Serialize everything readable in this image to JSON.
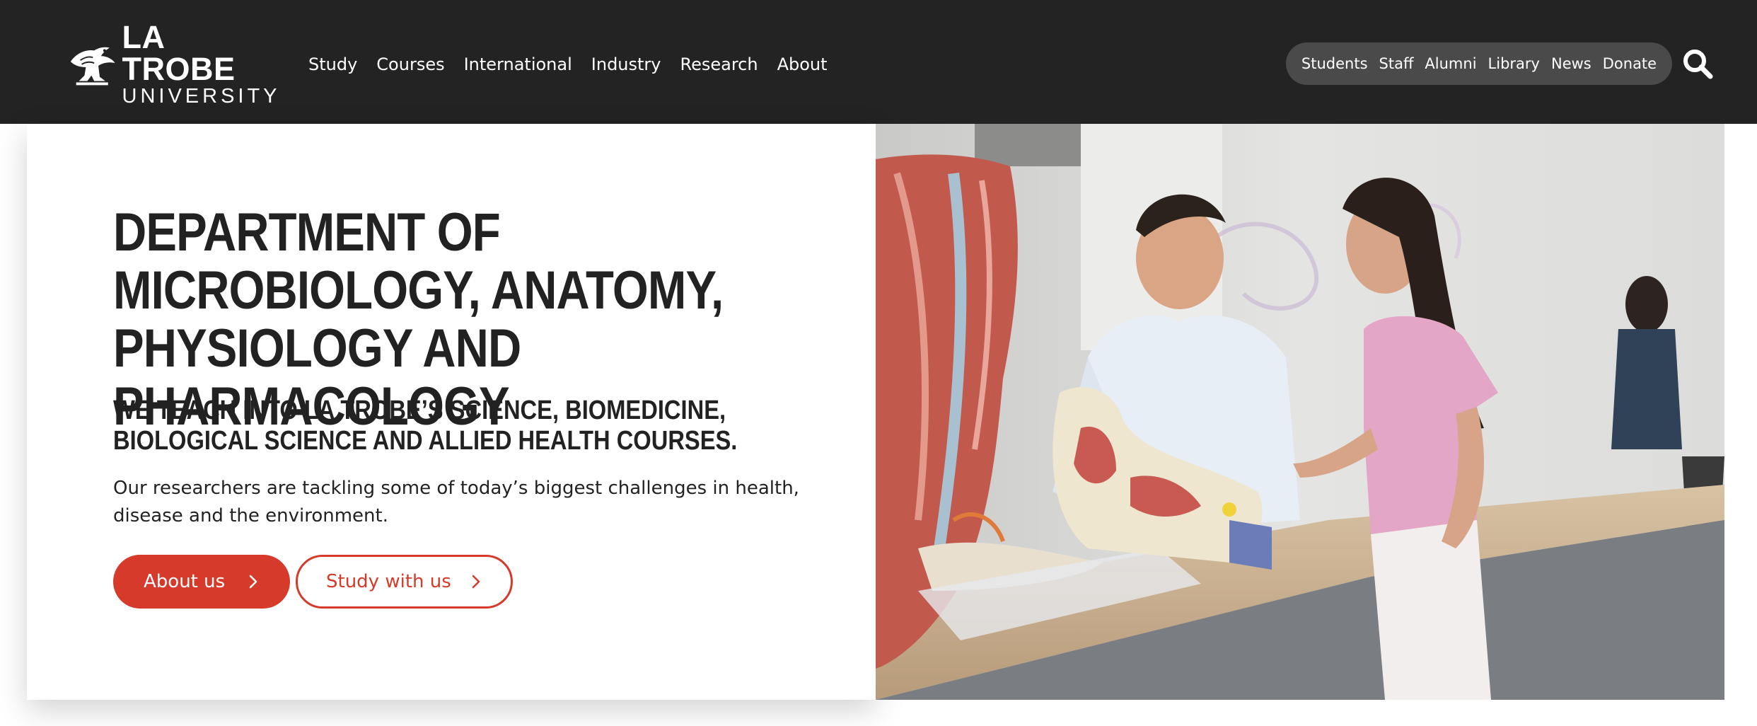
{
  "header": {
    "logo": {
      "line1": "LA TROBE",
      "line2": "UNIVERSITY"
    },
    "main_nav": [
      "Study",
      "Courses",
      "International",
      "Industry",
      "Research",
      "About"
    ],
    "utility_nav": [
      "Students",
      "Staff",
      "Alumni",
      "Library",
      "News",
      "Donate"
    ],
    "search_icon": "search-icon"
  },
  "hero": {
    "heading": "DEPARTMENT OF MICROBIOLOGY, ANATOMY, PHYSIOLOGY AND PHARMACOLOGY",
    "subheading": "WE TEACH INTO LA TROBE’S SCIENCE, BIOMEDICINE, BIOLOGICAL SCIENCE AND ALLIED HEALTH COURSES.",
    "description": "Our researchers are tackling some of today’s biggest challenges in health, disease and the environment.",
    "primary_button": "About us",
    "secondary_button": "Study with us",
    "button_icon": "chevron-right-icon"
  },
  "colors": {
    "header_bg": "#232323",
    "utility_pill_bg": "#4a4a4a",
    "accent_red": "#d53a2a",
    "text": "#222222"
  }
}
